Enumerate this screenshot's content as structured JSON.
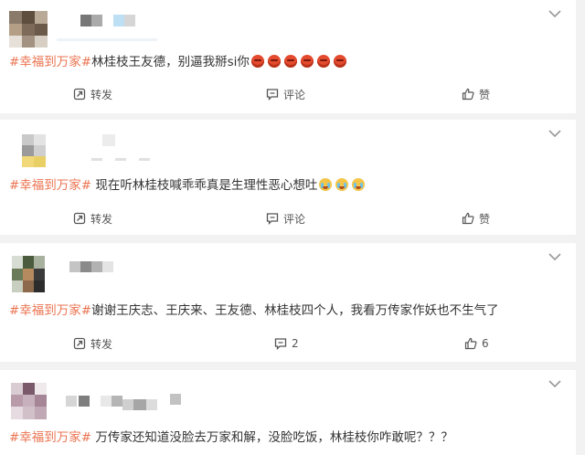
{
  "posts": [
    {
      "tag": "#幸福到万家#",
      "body": "林桂枝王友德，别逼我掰si你",
      "emojis": [
        "angry-emoji",
        "angry-emoji",
        "angry-emoji",
        "angry-emoji",
        "angry-emoji",
        "angry-emoji"
      ],
      "actions": {
        "repost": "转发",
        "comment": "评论",
        "like": "赞"
      }
    },
    {
      "tag": "#幸福到万家#",
      "body": " 现在听林桂枝喊乖乖真是生理性恶心想吐",
      "emojis": [
        "crying-emoji",
        "crying-emoji",
        "crying-emoji"
      ],
      "actions": {
        "repost": "转发",
        "comment": "评论",
        "like": "赞"
      }
    },
    {
      "tag": "#幸福到万家#",
      "body": "谢谢王庆志、王庆来、王友德、林桂枝四个人，我看万传家作妖也不生气了",
      "emojis": [],
      "actions": {
        "repost": "转发",
        "comment": "2",
        "like": "6"
      }
    },
    {
      "tag": "#幸福到万家#",
      "body": " 万传家还知道没脸去万家和解，没脸吃饭，林桂枝你咋敢呢？？？",
      "emojis": [],
      "actions": {}
    }
  ],
  "icons": {
    "menu": "chevron-down-icon",
    "repost": "repost-icon",
    "comment": "comment-icon",
    "like": "thumbs-up-icon"
  },
  "colors": {
    "hashtag": "#eb7350",
    "background": "#f2f2f2",
    "card": "#ffffff",
    "text": "#333333",
    "icon": "#555555"
  }
}
